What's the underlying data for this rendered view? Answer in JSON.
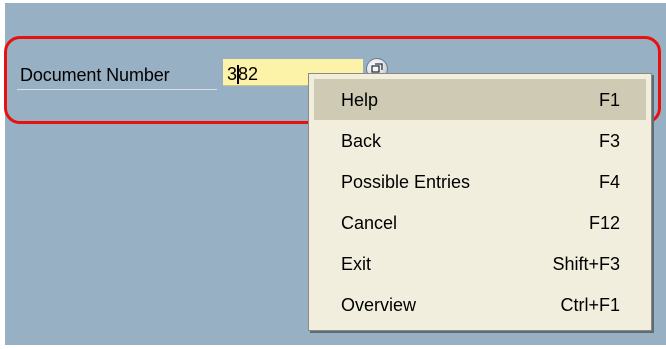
{
  "form": {
    "field_label": "Document Number",
    "field_value": "382",
    "field_value_rest": "82",
    "field_value_first": "3",
    "f4_button": "possible-entries-icon"
  },
  "menu": {
    "items": [
      {
        "label": "Help",
        "shortcut": "F1",
        "selected": true
      },
      {
        "label": "Back",
        "shortcut": "F3"
      },
      {
        "label": "Possible Entries",
        "shortcut": "F4"
      },
      {
        "label": "Cancel",
        "shortcut": "F12"
      },
      {
        "label": "Exit",
        "shortcut": "Shift+F3"
      },
      {
        "label": "Overview",
        "shortcut": "Ctrl+F1"
      }
    ]
  },
  "colors": {
    "screen_background": "#98b0c4",
    "input_background": "#fdf3a8",
    "menu_background": "#f1eedd",
    "selected_item": "#cfcab4",
    "highlight_ring": "#e8110f"
  }
}
